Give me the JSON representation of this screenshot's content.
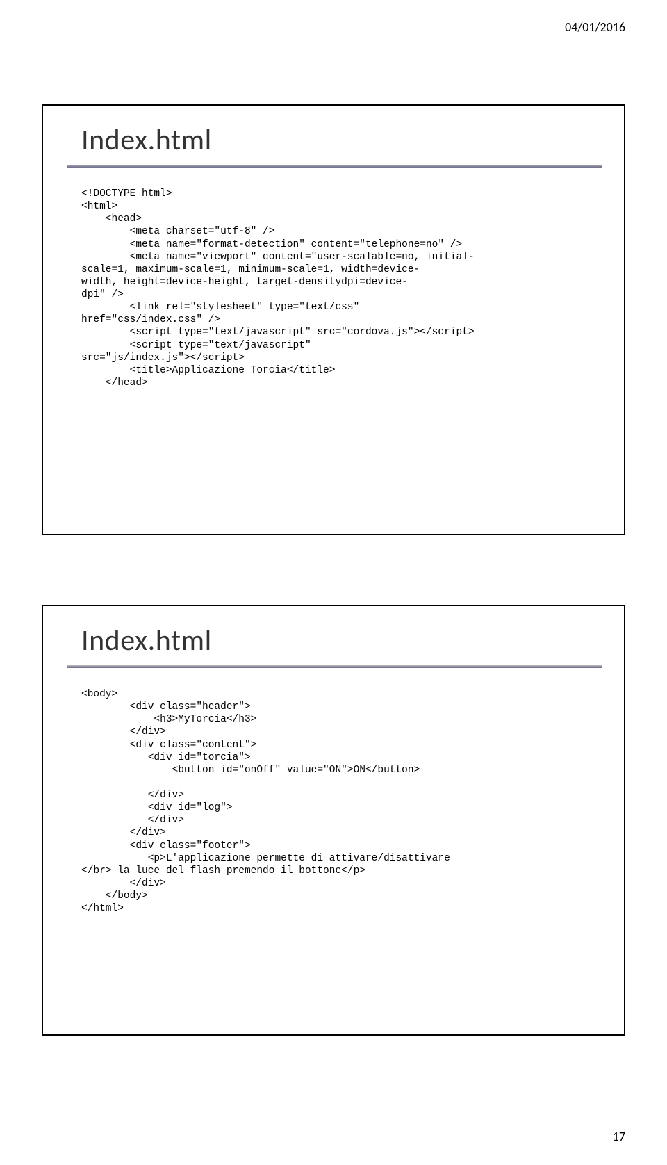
{
  "page_date": "04/01/2016",
  "page_number": "17",
  "slide1": {
    "title": "Index.html",
    "code": "<!DOCTYPE html>\n<html>\n    <head>\n        <meta charset=\"utf-8\" />\n        <meta name=\"format-detection\" content=\"telephone=no\" />\n        <meta name=\"viewport\" content=\"user-scalable=no, initial-\nscale=1, maximum-scale=1, minimum-scale=1, width=device-\nwidth, height=device-height, target-densitydpi=device-\ndpi\" />\n        <link rel=\"stylesheet\" type=\"text/css\" \nhref=\"css/index.css\" />\n        <script type=\"text/javascript\" src=\"cordova.js\"></script>\n        <script type=\"text/javascript\" \nsrc=\"js/index.js\"></script>\n        <title>Applicazione Torcia</title>\n    </head>"
  },
  "slide2": {
    "title": "Index.html",
    "code": "<body>\n        <div class=\"header\">\n            <h3>MyTorcia</h3>\n        </div>\n        <div class=\"content\">\n           <div id=\"torcia\">\n               <button id=\"onOff\" value=\"ON\">ON</button>\n\n           </div>\n           <div id=\"log\">\n           </div>\n        </div>\n        <div class=\"footer\">\n           <p>L'applicazione permette di attivare/disattivare \n</br> la luce del flash premendo il bottone</p>\n        </div>\n    </body>\n</html>"
  }
}
